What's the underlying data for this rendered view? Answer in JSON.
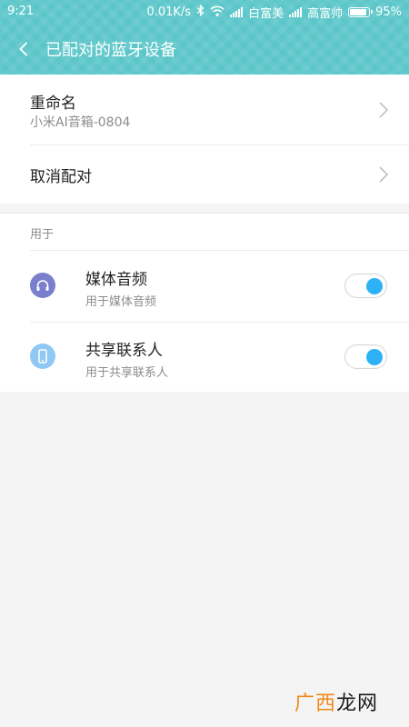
{
  "status_bar": {
    "time": "9:21",
    "speed": "0.01K/s",
    "carrier1": "白富美",
    "carrier2": "高富帅",
    "battery": "95%",
    "battery_level": 0.95
  },
  "header": {
    "title": "已配对的蓝牙设备",
    "background_color": "#5bc6c9"
  },
  "rename": {
    "label": "重命名",
    "device_name": "小米AI音箱-0804"
  },
  "unpair": {
    "label": "取消配对"
  },
  "used_for": {
    "section_label": "用于",
    "items": [
      {
        "title": "媒体音频",
        "subtitle": "用于媒体音频",
        "icon": "headphones-icon",
        "icon_color": "#7a7fcd",
        "enabled": true
      },
      {
        "title": "共享联系人",
        "subtitle": "用于共享联系人",
        "icon": "phone-icon",
        "icon_color": "#8fc8f2",
        "enabled": true
      }
    ]
  },
  "toggle_color": "#2db2f5",
  "watermark": {
    "accent_part": "广西",
    "rest_part": "龙网"
  }
}
